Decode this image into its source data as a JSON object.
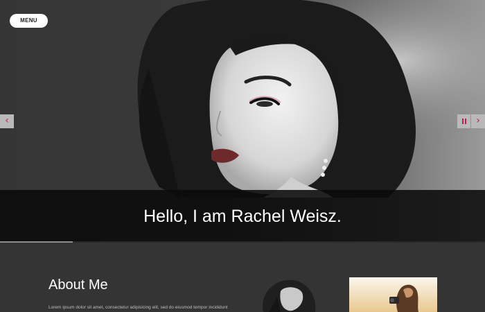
{
  "header": {
    "menu_label": "MENU"
  },
  "slider": {
    "caption": "Hello, I am Rachel Weisz.",
    "prev_glyph": "‹",
    "next_glyph": "›",
    "progress_fraction": 0.15
  },
  "about": {
    "heading": "About Me",
    "text": "Lorem ipsum dolor sit amet, consectetur adipisicing elit, sed do eiusmod tempor incididunt"
  },
  "colors": {
    "accent": "#c2185b",
    "background": "#343434",
    "caption_band": "#0a0a0a"
  },
  "icons": {
    "prev": "chevron-left-icon",
    "next": "chevron-right-icon",
    "pause": "pause-icon"
  }
}
